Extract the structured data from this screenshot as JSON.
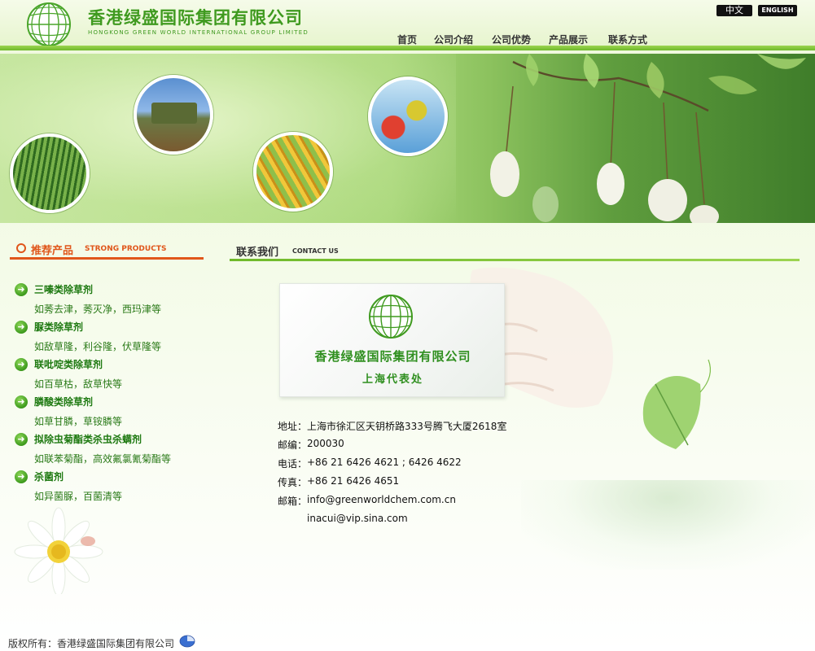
{
  "header": {
    "company_name": "香港绿盛国际集团有限公司",
    "company_name_en": "HONGKONG GREEN WORLD INTERNATIONAL GROUP LIMITED",
    "lang_cn": "中文",
    "lang_en": "ENGLISH",
    "nav": [
      {
        "label": "首页"
      },
      {
        "label": "公司介绍"
      },
      {
        "label": "公司优势"
      },
      {
        "label": "产品展示"
      },
      {
        "label": "联系方式"
      }
    ]
  },
  "products": {
    "title": "推荐产品",
    "title_en": "STRONG PRODUCTS",
    "items": [
      {
        "name": "三嗪类除草剂",
        "desc": "如莠去津，莠灭净，西玛津等"
      },
      {
        "name": "脲类除草剂",
        "desc": "如敌草隆，利谷隆，伏草隆等"
      },
      {
        "name": "联吡啶类除草剂",
        "desc": "如百草枯，敌草快等"
      },
      {
        "name": "膦酸类除草剂",
        "desc": "如草甘膦，草铵膦等"
      },
      {
        "name": "拟除虫菊酯类杀虫杀螨剂",
        "desc": "如联苯菊酯，高效氟氯氰菊酯等"
      },
      {
        "name": "杀菌剂",
        "desc": "如异菌脲，百菌清等"
      }
    ]
  },
  "contact": {
    "title": "联系我们",
    "title_en": "CONTACT US",
    "card_name": "香港绿盛国际集团有限公司",
    "card_office": "上海代表处",
    "rows": [
      {
        "label": "地址：",
        "value": "上海市徐汇区天钥桥路333号腾飞大厦2618室"
      },
      {
        "label": "邮编：",
        "value": "200030"
      },
      {
        "label": "电话：",
        "value": "+86 21 6426 4621 ; 6426 4622"
      },
      {
        "label": "传真：",
        "value": "+86 21 6426 4651"
      },
      {
        "label": "邮箱：",
        "value": "info@greenworldchem.com.cn"
      },
      {
        "label": "",
        "value": "inacui@vip.sina.com"
      }
    ]
  },
  "footer": {
    "copyright": "版权所有：香港绿盛国际集团有限公司"
  },
  "colors": {
    "brand_green": "#3f9a1f",
    "accent_orange": "#e0561a",
    "nav_rule_green": "#6fba2a"
  },
  "icons": [
    "globe-logo-icon",
    "arrow-right-icon",
    "daisy-icon",
    "pie-icon"
  ]
}
